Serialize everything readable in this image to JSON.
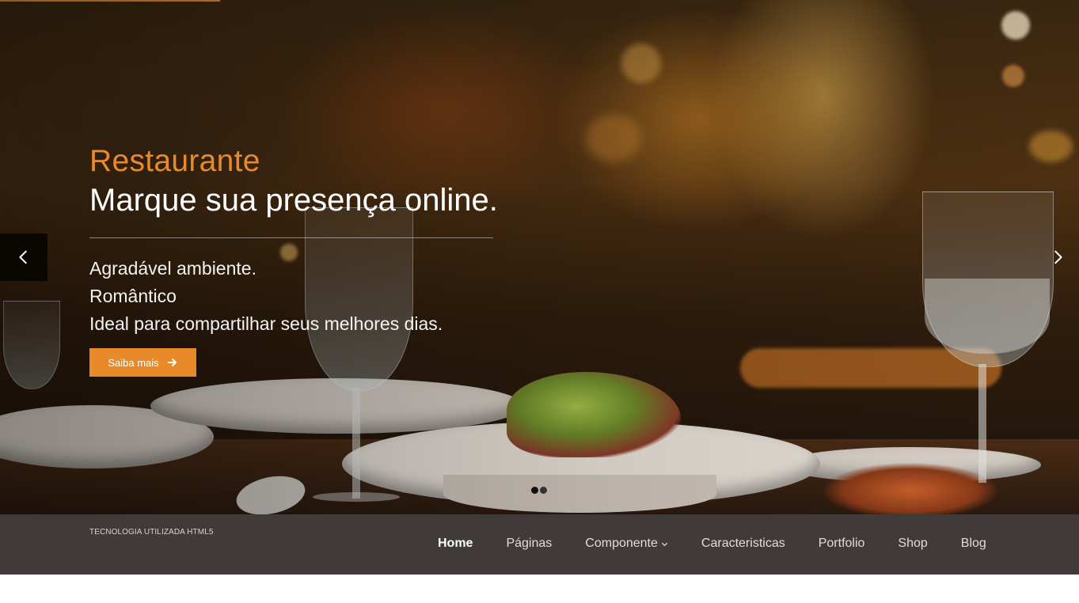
{
  "hero": {
    "eyebrow": "Restaurante",
    "title": "Marque sua presença online.",
    "lines": [
      "Agradável ambiente.",
      "Romântico",
      "Ideal para compartilhar seus melhores dias."
    ],
    "cta_label": "Saiba mais",
    "cta_icon": "arrow-right-icon",
    "prev_icon": "chevron-left-icon",
    "next_icon": "chevron-right-icon",
    "slide_count": 2,
    "active_slide": 1,
    "accent_color": "#e88a2a"
  },
  "navbar": {
    "brand_text": "TECNOLOGIA UTILIZADA HTML5",
    "background": "#403b38",
    "items": [
      {
        "label": "Home",
        "active": true
      },
      {
        "label": "Páginas"
      },
      {
        "label": "Componente",
        "dropdown": true
      },
      {
        "label": "Caracteristicas"
      },
      {
        "label": "Portfolio"
      },
      {
        "label": "Shop"
      },
      {
        "label": "Blog"
      }
    ]
  }
}
